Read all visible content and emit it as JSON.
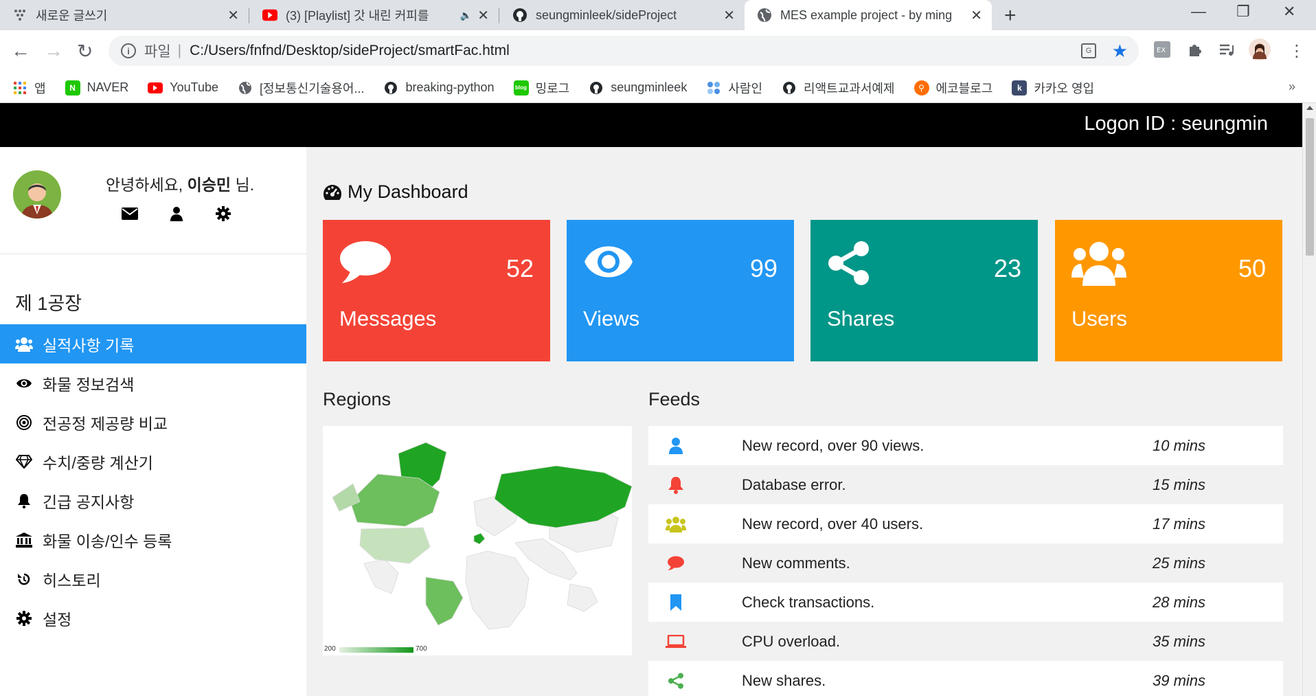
{
  "browser": {
    "tabs": [
      {
        "title": "새로운 글쓰기",
        "icon": "dots-icon"
      },
      {
        "title": "(3) [Playlist] 갓 내린 커피를",
        "icon": "youtube-icon",
        "muted": true
      },
      {
        "title": "seungminleek/sideProject",
        "icon": "github-icon"
      },
      {
        "title": "MES example project - by ming",
        "icon": "globe-icon",
        "active": true
      }
    ],
    "address": {
      "scheme": "파일",
      "url": "C:/Users/fnfnd/Desktop/sideProject/smartFac.html"
    },
    "bookmarks": [
      {
        "label": "앱",
        "icon": "apps-icon"
      },
      {
        "label": "NAVER",
        "icon": "naver-icon"
      },
      {
        "label": "YouTube",
        "icon": "youtube-icon"
      },
      {
        "label": "[정보통신기술용어...",
        "icon": "globe-icon"
      },
      {
        "label": "breaking-python",
        "icon": "github-icon"
      },
      {
        "label": "밍로그",
        "icon": "blog-icon"
      },
      {
        "label": "seungminleek",
        "icon": "github-icon"
      },
      {
        "label": "사람인",
        "icon": "saramin-icon"
      },
      {
        "label": "리액트교과서예제",
        "icon": "github-icon"
      },
      {
        "label": "에코블로그",
        "icon": "eco-icon"
      },
      {
        "label": "카카오 영입",
        "icon": "k-icon"
      }
    ],
    "bookmarks_more": "»"
  },
  "header": {
    "logon": "Logon ID : seungmin"
  },
  "profile": {
    "greeting_prefix": "안녕하세요, ",
    "name": "이승민",
    "greeting_suffix": " 님."
  },
  "sidebar": {
    "factory": "제 1공장",
    "items": [
      {
        "label": "실적사항 기록",
        "icon": "users-icon",
        "active": true
      },
      {
        "label": "화물 정보검색",
        "icon": "eye-icon"
      },
      {
        "label": "전공정 제공량 비교",
        "icon": "target-icon"
      },
      {
        "label": "수치/중량 계산기",
        "icon": "diamond-icon"
      },
      {
        "label": "긴급 공지사항",
        "icon": "bell-icon"
      },
      {
        "label": "화물 이송/인수 등록",
        "icon": "bank-icon"
      },
      {
        "label": "히스토리",
        "icon": "history-icon"
      },
      {
        "label": "설정",
        "icon": "cog-icon"
      }
    ]
  },
  "dashboard": {
    "title": "My Dashboard",
    "cards": [
      {
        "label": "Messages",
        "value": "52",
        "color": "#f44336",
        "icon": "comment-icon"
      },
      {
        "label": "Views",
        "value": "99",
        "color": "#2196f3",
        "icon": "eye-icon"
      },
      {
        "label": "Shares",
        "value": "23",
        "color": "#009688",
        "icon": "share-icon"
      },
      {
        "label": "Users",
        "value": "50",
        "color": "#ff9800",
        "icon": "users-icon"
      }
    ],
    "regions_title": "Regions",
    "map_legend": {
      "min": "200",
      "max": "700"
    },
    "feeds_title": "Feeds",
    "feeds": [
      {
        "text": "New record, over 90 views.",
        "time": "10 mins",
        "icon": "user-icon",
        "color": "#2196f3"
      },
      {
        "text": "Database error.",
        "time": "15 mins",
        "icon": "bell-icon",
        "color": "#f44336"
      },
      {
        "text": "New record, over 40 users.",
        "time": "17 mins",
        "icon": "users-icon",
        "color": "#cddc39"
      },
      {
        "text": "New comments.",
        "time": "25 mins",
        "icon": "comment-icon",
        "color": "#f44336"
      },
      {
        "text": "Check transactions.",
        "time": "28 mins",
        "icon": "bookmark-icon",
        "color": "#2196f3"
      },
      {
        "text": "CPU overload.",
        "time": "35 mins",
        "icon": "laptop-icon",
        "color": "#f44336"
      },
      {
        "text": "New shares.",
        "time": "39 mins",
        "icon": "share-icon",
        "color": "#4caf50"
      }
    ]
  }
}
